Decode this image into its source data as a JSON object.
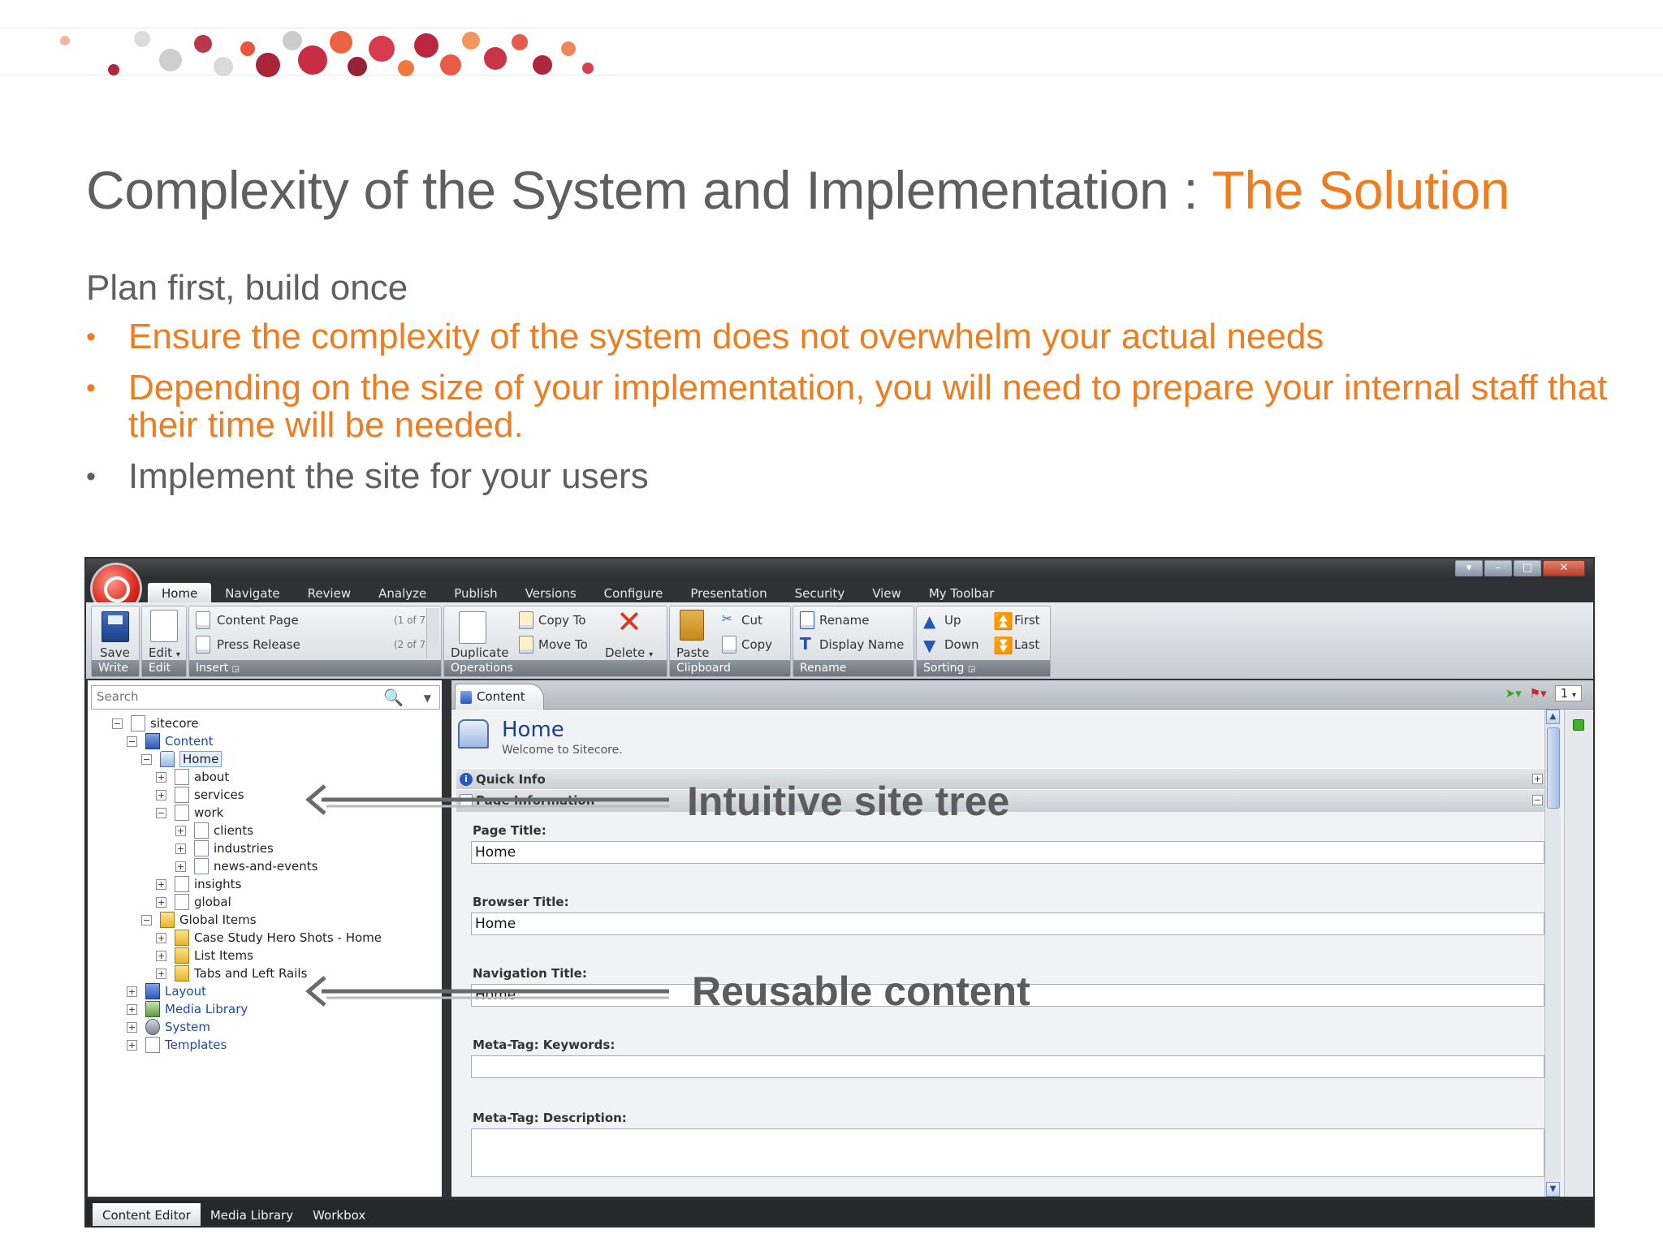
{
  "slide": {
    "title_main": "Complexity of the System and Implementation : ",
    "title_accent": "The Solution",
    "subtitle": "Plan first, build once",
    "bullets": [
      "Ensure the complexity of the system does not overwhelm your actual needs",
      "Depending on the size of your implementation, you will need to prepare your internal staff that their time will be needed.",
      "Implement the site for your users"
    ]
  },
  "colors": {
    "accent": "#ee7d22",
    "text": "#5f5f5f"
  },
  "app": {
    "tabs": [
      "Home",
      "Navigate",
      "Review",
      "Analyze",
      "Publish",
      "Versions",
      "Configure",
      "Presentation",
      "Security",
      "View",
      "My Toolbar"
    ],
    "ribbon": {
      "write": {
        "button": "Save",
        "label": "Write"
      },
      "edit": {
        "button": "Edit",
        "label": "Edit"
      },
      "insert": {
        "items": [
          {
            "name": "Content Page",
            "count": "(1 of 7)"
          },
          {
            "name": "Press Release",
            "count": "(2 of 7)"
          }
        ],
        "label": "Insert"
      },
      "operations": {
        "duplicate": "Duplicate",
        "copy_to": "Copy To",
        "move_to": "Move To",
        "delete": "Delete",
        "label": "Operations"
      },
      "clipboard": {
        "paste": "Paste",
        "cut": "Cut",
        "copy": "Copy",
        "label": "Clipboard"
      },
      "rename": {
        "rename": "Rename",
        "display_name": "Display Name",
        "label": "Rename"
      },
      "sorting": {
        "up": "Up",
        "down": "Down",
        "first": "First",
        "last": "Last",
        "label": "Sorting"
      }
    },
    "search": {
      "placeholder": "Search"
    },
    "tree": [
      {
        "label": "sitecore",
        "exp": "−",
        "icon": "page-icon"
      },
      {
        "label": "Content",
        "exp": "−",
        "icon": "content-icon"
      },
      {
        "label": "Home",
        "exp": "−",
        "icon": "home-icon"
      },
      {
        "label": "about",
        "exp": "+",
        "icon": "page-icon"
      },
      {
        "label": "services",
        "exp": "+",
        "icon": "page-icon"
      },
      {
        "label": "work",
        "exp": "−",
        "icon": "page-icon"
      },
      {
        "label": "clients",
        "exp": "+",
        "icon": "page-icon"
      },
      {
        "label": "industries",
        "exp": "+",
        "icon": "page-icon"
      },
      {
        "label": "news-and-events",
        "exp": "+",
        "icon": "page-icon"
      },
      {
        "label": "insights",
        "exp": "+",
        "icon": "page-icon"
      },
      {
        "label": "global",
        "exp": "+",
        "icon": "page-icon"
      },
      {
        "label": "Global Items",
        "exp": "−",
        "icon": "folder-icon"
      },
      {
        "label": "Case Study Hero Shots - Home",
        "exp": "+",
        "icon": "folder-icon"
      },
      {
        "label": "List Items",
        "exp": "+",
        "icon": "folder-icon"
      },
      {
        "label": "Tabs and Left Rails",
        "exp": "+",
        "icon": "folder-icon"
      },
      {
        "label": "Layout",
        "exp": "+",
        "icon": "layout-icon"
      },
      {
        "label": "Media Library",
        "exp": "+",
        "icon": "media-icon"
      },
      {
        "label": "System",
        "exp": "+",
        "icon": "system-icon"
      },
      {
        "label": "Templates",
        "exp": "+",
        "icon": "page-icon"
      }
    ],
    "content": {
      "tab": "Content",
      "item_title": "Home",
      "item_subtitle": "Welcome to Sitecore.",
      "sections": {
        "quick_info": "Quick Info",
        "page_information": "Page Information"
      },
      "fields": [
        {
          "label": "Page Title:",
          "value": "Home"
        },
        {
          "label": "Browser Title:",
          "value": "Home"
        },
        {
          "label": "Navigation Title:",
          "value": "Home"
        },
        {
          "label": "Meta-Tag: Keywords:",
          "value": ""
        },
        {
          "label": "Meta-Tag: Description:",
          "value": ""
        }
      ],
      "version_selector": "1"
    },
    "status_tabs": [
      "Content Editor",
      "Media Library",
      "Workbox"
    ]
  },
  "callouts": {
    "tree": "Intuitive site tree",
    "reusable": "Reusable content"
  }
}
